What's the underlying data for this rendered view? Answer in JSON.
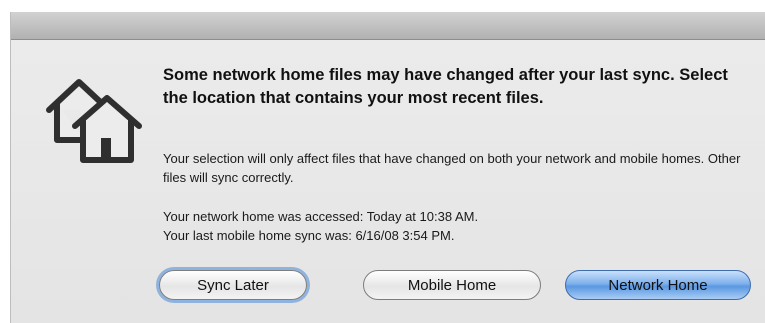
{
  "dialog": {
    "headline": "Some network home files may have changed after your last sync. Select the location that contains your most recent files.",
    "selection_info": "Your selection will only affect files that have changed on both your network and mobile homes. Other files will sync correctly.",
    "network_access": "Your network home was accessed: Today at 10:38 AM.",
    "last_sync": "Your last mobile home sync was: 6/16/08 3:54 PM."
  },
  "buttons": {
    "sync_later": "Sync Later",
    "mobile_home": "Mobile Home",
    "network_home": "Network Home"
  },
  "icons": {
    "dialog_icon": "houses-icon"
  },
  "colors": {
    "default_button": "#5b98e2",
    "focus_ring": "#8fb3de"
  }
}
